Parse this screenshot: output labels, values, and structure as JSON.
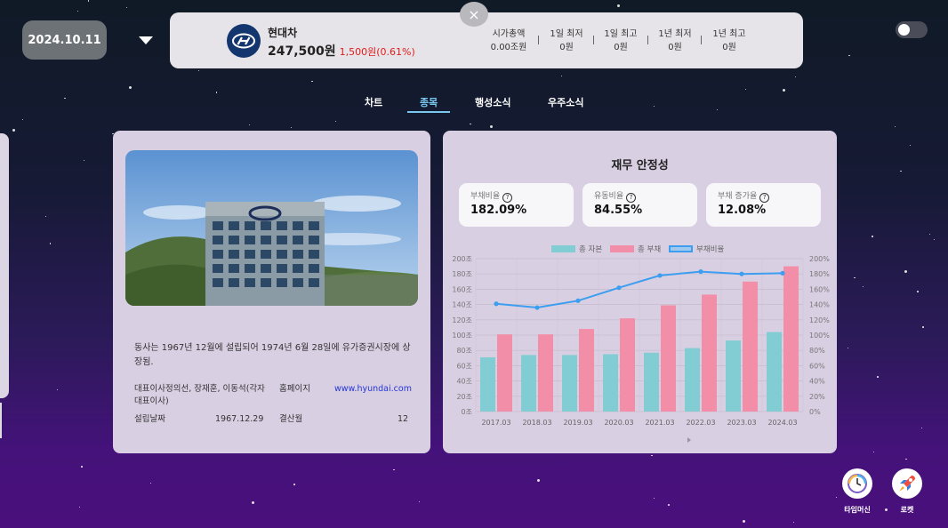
{
  "date": "2024.10.11",
  "close_symbol": "×",
  "stock": {
    "name": "현대차",
    "price": "247,500원",
    "change": "1,500원(0.61%)"
  },
  "stats": [
    {
      "label": "시가총액",
      "value": "0.00조원"
    },
    {
      "label": "1일 최저",
      "value": "0원"
    },
    {
      "label": "1일 최고",
      "value": "0원"
    },
    {
      "label": "1년 최저",
      "value": "0원"
    },
    {
      "label": "1년 최고",
      "value": "0원"
    }
  ],
  "tabs": [
    "차트",
    "종목",
    "행성소식",
    "우주소식"
  ],
  "active_tab": "종목",
  "company": {
    "description": "동사는 1967년 12월에 설립되어 1974년 6월 28일에 유가증권시장에 상장됨.",
    "ceo_label": "대표이사",
    "ceo_value": "정의선, 장재훈, 이동석(각자대표이사)",
    "homepage_label": "홈페이지",
    "homepage_value": "www.hyundai.com",
    "founded_label": "설립날짜",
    "founded_value": "1967.12.29",
    "fiscal_label": "결산월",
    "fiscal_value": "12"
  },
  "financial": {
    "title": "재무 안정성",
    "metrics": [
      {
        "label": "부채비율",
        "value": "182.09%"
      },
      {
        "label": "유동비율",
        "value": "84.55%"
      },
      {
        "label": "부채 증가율",
        "value": "12.08%"
      }
    ]
  },
  "chart_data": {
    "type": "bar",
    "categories": [
      "2017.03",
      "2018.03",
      "2019.03",
      "2020.03",
      "2021.03",
      "2022.03",
      "2023.03",
      "2024.03"
    ],
    "series": [
      {
        "name": "총 자본",
        "type": "bar",
        "axis": "left",
        "color": "#82cdd3",
        "values": [
          71,
          74,
          74,
          75,
          77,
          83,
          93,
          104
        ]
      },
      {
        "name": "총 부채",
        "type": "bar",
        "axis": "left",
        "color": "#f28ea8",
        "values": [
          101,
          101,
          108,
          122,
          139,
          153,
          170,
          190
        ]
      },
      {
        "name": "부채비율",
        "type": "line",
        "axis": "right",
        "color": "#3d9ef0",
        "values": [
          141,
          136,
          145,
          162,
          178,
          183,
          180,
          181
        ]
      }
    ],
    "y_left_ticks": [
      "0조",
      "20조",
      "40조",
      "60조",
      "80조",
      "100조",
      "120조",
      "140조",
      "160조",
      "180조",
      "200조"
    ],
    "y_right_ticks": [
      "0%",
      "20%",
      "40%",
      "60%",
      "80%",
      "100%",
      "120%",
      "140%",
      "160%",
      "180%",
      "200%"
    ],
    "ylim": [
      0,
      200
    ],
    "grid": true,
    "legend": "top"
  },
  "fabs": [
    {
      "label": "타임머신",
      "icon": "clock-icon"
    },
    {
      "label": "로켓",
      "icon": "rocket-icon"
    }
  ]
}
